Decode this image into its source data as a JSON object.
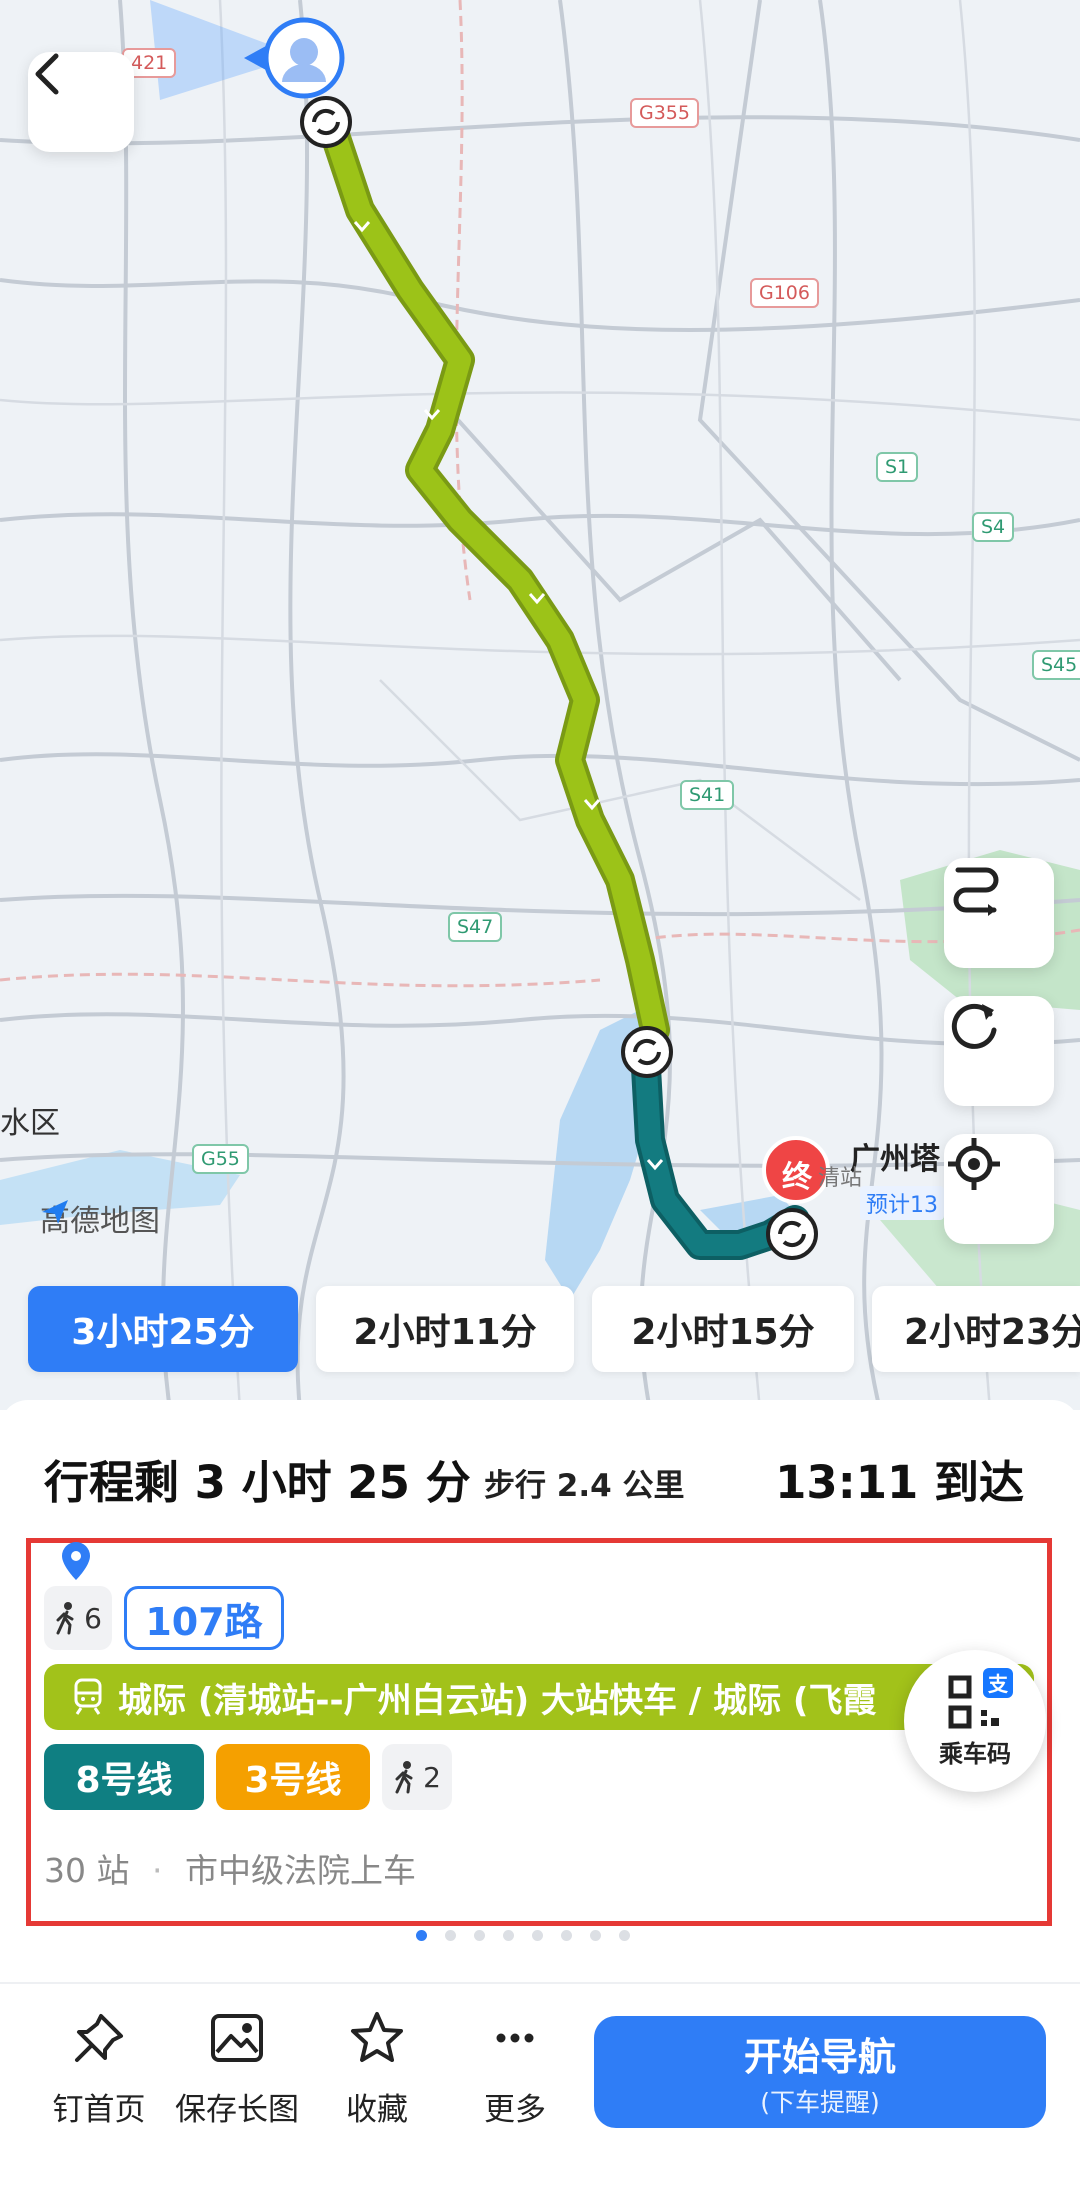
{
  "map": {
    "logo": "高德地图",
    "road_tags": [
      "421",
      "G355",
      "G106",
      "S1",
      "S4",
      "S45",
      "S41",
      "S47",
      "G55"
    ],
    "place_labels": [
      "水区",
      "广州塔",
      "预计13",
      "清站"
    ],
    "end_marker": "终"
  },
  "route_options": [
    {
      "label": "3小时25分",
      "active": true
    },
    {
      "label": "2小时11分",
      "active": false
    },
    {
      "label": "2小时15分",
      "active": false
    },
    {
      "label": "2小时23分",
      "active": false
    }
  ],
  "summary": {
    "remaining": "行程剩 3 小时 25 分",
    "walk": "步行 2.4 公里",
    "arrive": "13:11 到达"
  },
  "plan": {
    "walk_start": "6",
    "bus": "107路",
    "rail": "城际 (清城站--广州白云站) 大站快车 / 城际 (飞霞",
    "metro_lines": [
      {
        "label": "8号线",
        "color": "#0f7f82"
      },
      {
        "label": "3号线",
        "color": "#f5a000"
      }
    ],
    "walk_end": "2",
    "stops": "30 站",
    "board": "市中级法院上车"
  },
  "qr": {
    "label": "乘车码",
    "badge": "支"
  },
  "pagination": {
    "total": 8,
    "active": 0
  },
  "bottom": {
    "pin": "钉首页",
    "save_image": "保存长图",
    "favorite": "收藏",
    "more": "更多",
    "nav_title": "开始导航",
    "nav_sub": "(下车提醒)"
  },
  "colors": {
    "accent": "#2f7df6",
    "rail": "#a2c21a",
    "route_green": "#9cc318",
    "route_teal": "#137b80",
    "highlight": "#e53935"
  },
  "icons": [
    "back-icon",
    "swap-route-icon",
    "refresh-icon",
    "locate-icon",
    "walk-icon",
    "train-icon",
    "pin-icon",
    "image-icon",
    "star-icon",
    "more-icon",
    "qr-icon"
  ]
}
